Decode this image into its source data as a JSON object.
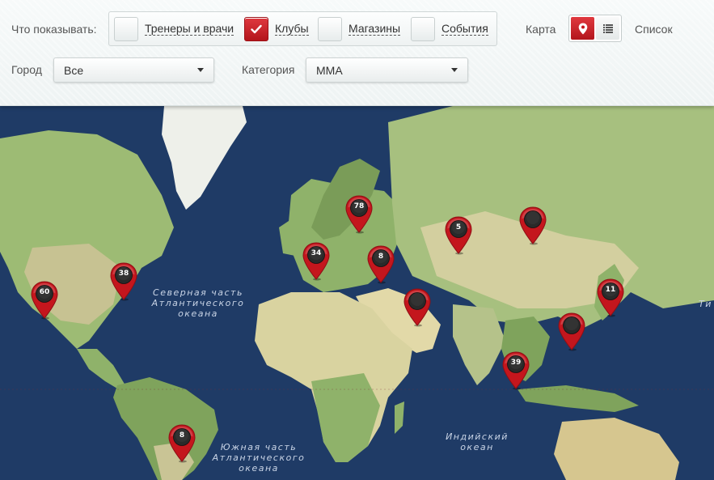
{
  "filters": {
    "show_label": "Что показывать:",
    "options": [
      {
        "label": "Тренеры и врачи",
        "checked": false
      },
      {
        "label": "Клубы",
        "checked": true
      },
      {
        "label": "Магазины",
        "checked": false
      },
      {
        "label": "События",
        "checked": false
      }
    ],
    "view_map_label": "Карта",
    "view_list_label": "Список",
    "active_view": "map",
    "city_label": "Город",
    "city_value": "Все",
    "category_label": "Категория",
    "category_value": "ММА"
  },
  "colors": {
    "accent": "#c4161d",
    "ocean": "#1f3b66",
    "land": "#a8bf84"
  },
  "map": {
    "ocean_labels": [
      {
        "lines": [
          "Северная часть",
          "Атлантического",
          "океана"
        ]
      },
      {
        "lines": [
          "Южная часть",
          "Атлантического",
          "океана"
        ]
      },
      {
        "lines": [
          "Индийский",
          "океан"
        ]
      },
      {
        "lines": [
          "Ти"
        ]
      }
    ],
    "markers": [
      {
        "name": "marker-north-america-west",
        "count": "60"
      },
      {
        "name": "marker-north-america-east",
        "count": "38"
      },
      {
        "name": "marker-scandinavia",
        "count": "78"
      },
      {
        "name": "marker-europe-west",
        "count": "34"
      },
      {
        "name": "marker-europe-east",
        "count": "8"
      },
      {
        "name": "marker-central-asia",
        "count": "5"
      },
      {
        "name": "marker-siberia",
        "count": ""
      },
      {
        "name": "marker-arabia",
        "count": ""
      },
      {
        "name": "marker-china-south",
        "count": ""
      },
      {
        "name": "marker-japan",
        "count": "11"
      },
      {
        "name": "marker-southeast-asia",
        "count": "39"
      },
      {
        "name": "marker-south-america",
        "count": "8"
      }
    ]
  }
}
